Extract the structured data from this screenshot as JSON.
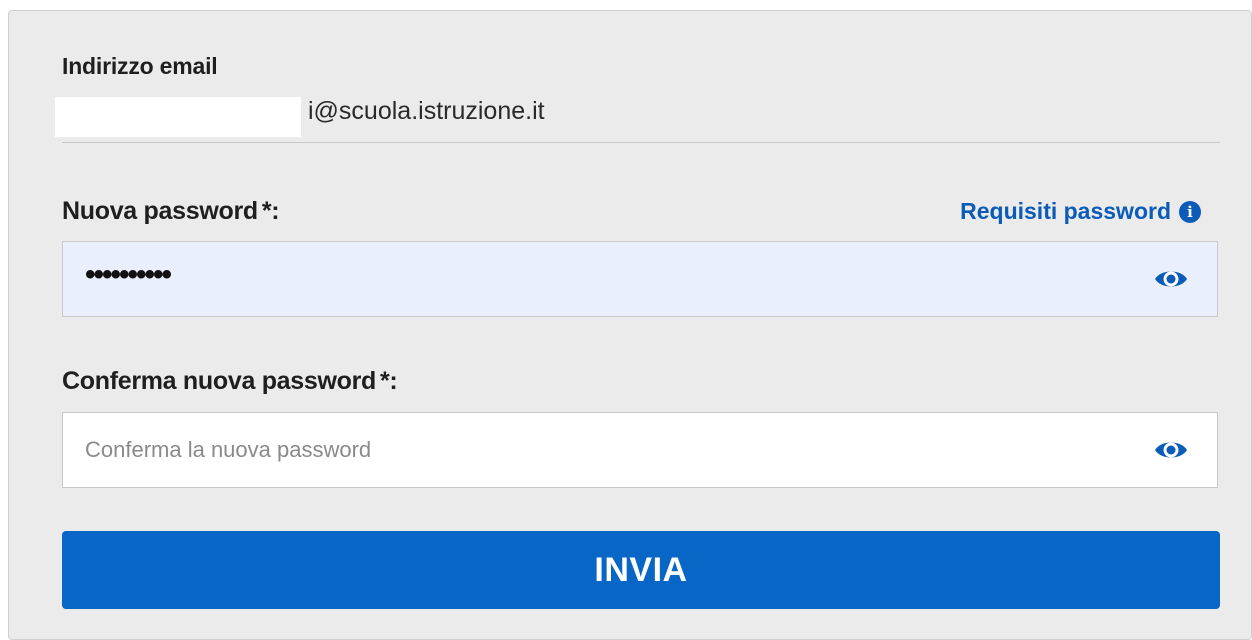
{
  "form": {
    "email_label": "Indirizzo email",
    "email_value": "i@scuola.istruzione.it",
    "new_password": {
      "label": "Nuova password",
      "required_mark": "*:",
      "value": "••••••••••",
      "requirements_link": "Requisiti password",
      "info_icon": "i"
    },
    "confirm_password": {
      "label": "Conferma nuova password",
      "required_mark": "*:",
      "placeholder": "Conferma la nuova password"
    },
    "submit_label": "INVIA"
  },
  "colors": {
    "panel_background": "#ebebeb",
    "accent": "#0866c6",
    "link": "#0b5bb8",
    "filled_input_background": "#e9effc"
  },
  "icons": {
    "show_password": "eye-icon",
    "info": "info-icon"
  }
}
